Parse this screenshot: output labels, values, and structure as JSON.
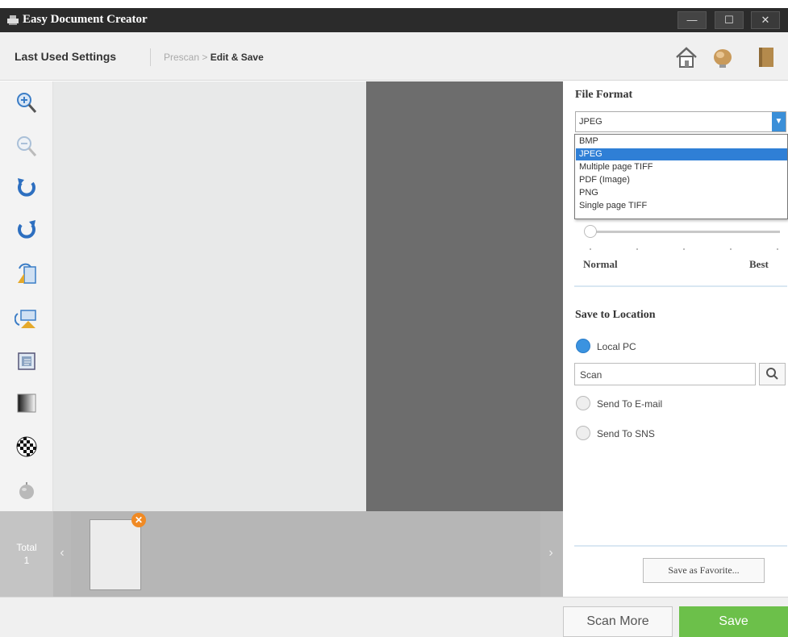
{
  "window": {
    "title": "Easy Document Creator",
    "minimize_glyph": "—",
    "maximize_glyph": "☐",
    "close_glyph": "✕"
  },
  "header": {
    "last_used_settings": "Last Used Settings",
    "breadcrumb_step1": "Prescan",
    "breadcrumb_sep": " > ",
    "breadcrumb_step2": "Edit & Save",
    "icons": [
      "home-icon",
      "tips-bulb-icon",
      "manual-book-icon"
    ]
  },
  "toolbar": {
    "tools": [
      "zoom-in-icon",
      "zoom-out-icon",
      "rotate-left-icon",
      "rotate-right-icon",
      "flip-horizontal-icon",
      "flip-vertical-icon",
      "crop-icon",
      "brightness-icon",
      "checkerboard-icon",
      "color-icon"
    ]
  },
  "filmstrip": {
    "total_label": "Total",
    "total_count": "1",
    "prev_arrow": "‹",
    "next_arrow": "›",
    "remove_glyph": "✕"
  },
  "right_panel": {
    "file_format_label": "File Format",
    "file_format_value": "JPEG",
    "file_format_options": [
      "BMP",
      "JPEG",
      "Multiple page TIFF",
      "PDF (Image)",
      "PNG",
      "Single page TIFF"
    ],
    "selected_option": "JPEG",
    "quality_low_label": "Normal",
    "quality_high_label": "Best",
    "quality_value_fraction": 0.0,
    "save_to_location_label": "Save to Location",
    "local_pc_label": "Local PC",
    "folder_value": "Scan",
    "send_email_label": "Send To E-mail",
    "send_sns_label": "Send To SNS",
    "save_favorite_label": "Save as Favorite..."
  },
  "bottom": {
    "scan_more_label": "Scan More",
    "save_label": "Save"
  },
  "colors": {
    "titlebar": "#2b2b2b",
    "accent_blue": "#3b8fd8",
    "save_green": "#6cc04a",
    "preview_dark": "#6d6d6d"
  }
}
